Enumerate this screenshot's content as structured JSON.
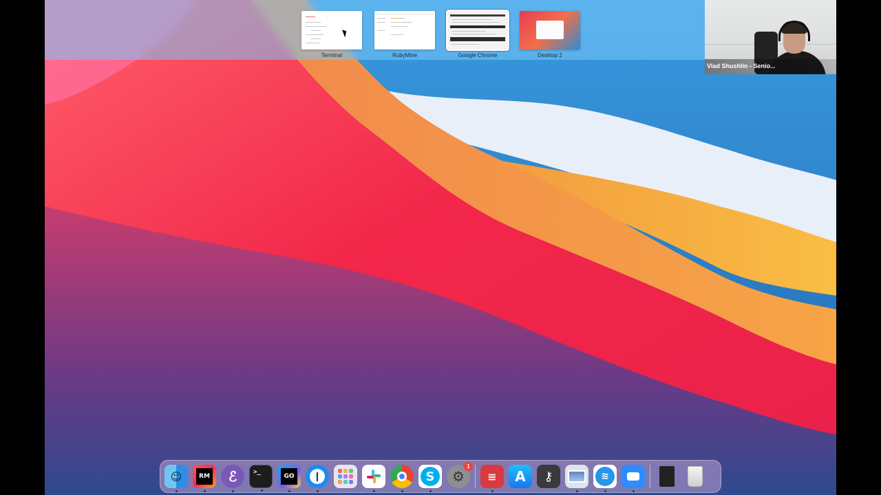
{
  "spaces": [
    {
      "label": "Terminal",
      "active": false
    },
    {
      "label": "RubyMine",
      "active": false
    },
    {
      "label": "Google Chrome",
      "active": true
    },
    {
      "label": "Desktop 2",
      "active": false
    }
  ],
  "video": {
    "participant_name": "Vlad Shushlin - Senio..."
  },
  "dock": {
    "items": [
      {
        "name": "finder",
        "icon": "finder-icon"
      },
      {
        "name": "rubymine",
        "icon": "rubymine-icon",
        "text": "RM"
      },
      {
        "name": "emacs",
        "icon": "emacs-icon"
      },
      {
        "name": "terminal",
        "icon": "terminal-icon",
        "text": ">_"
      },
      {
        "name": "goland",
        "icon": "goland-icon",
        "text": "GO"
      },
      {
        "name": "1password",
        "icon": "1password-icon"
      },
      {
        "name": "launchpad",
        "icon": "launchpad-icon"
      },
      {
        "name": "slack",
        "icon": "slack-icon"
      },
      {
        "name": "chrome",
        "icon": "chrome-icon"
      },
      {
        "name": "skype",
        "icon": "skype-icon"
      },
      {
        "name": "system-preferences",
        "icon": "gear-icon",
        "badge": "1"
      },
      {
        "name": "expressvpn",
        "icon": "expressvpn-icon"
      },
      {
        "name": "app-store",
        "icon": "app-store-icon"
      },
      {
        "name": "keychain",
        "icon": "keychain-icon"
      },
      {
        "name": "preview",
        "icon": "preview-icon"
      },
      {
        "name": "docker",
        "icon": "docker-icon"
      },
      {
        "name": "zoom",
        "icon": "zoom-icon"
      },
      {
        "name": "document",
        "icon": "document-icon"
      },
      {
        "name": "trash",
        "icon": "trash-icon"
      }
    ]
  },
  "colors": {
    "wallpaper_red": "#f2274a",
    "wallpaper_orange": "#f56d45",
    "wallpaper_blue": "#1f7cc6",
    "wallpaper_yellow": "#f7a83c"
  }
}
